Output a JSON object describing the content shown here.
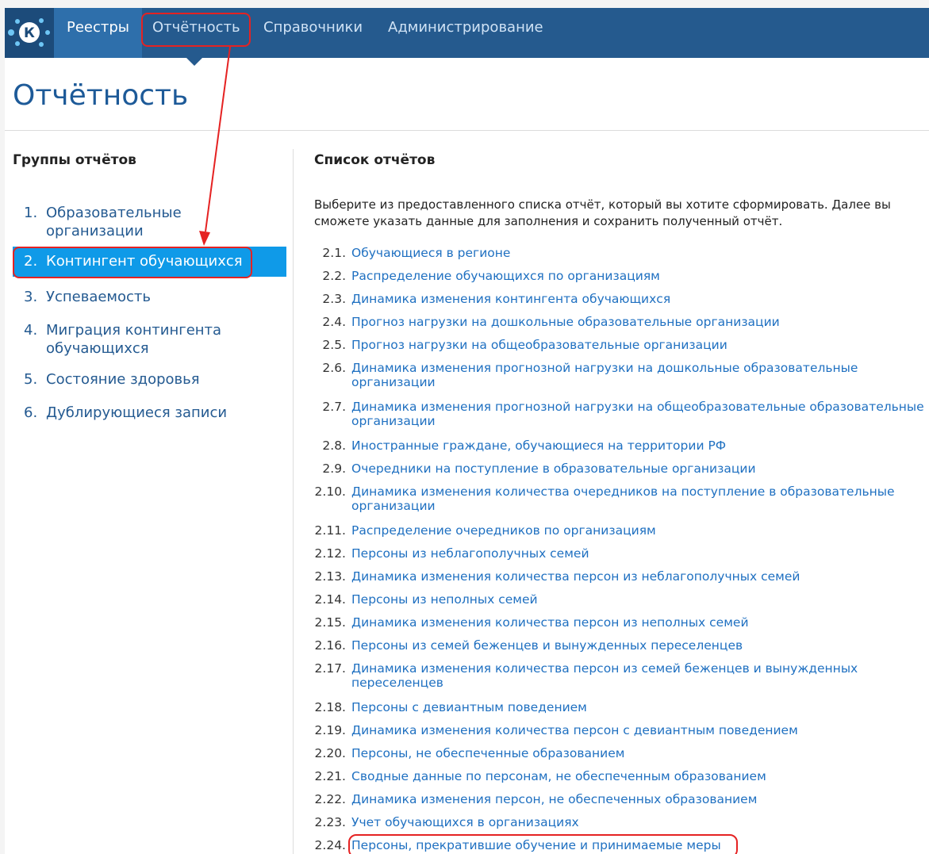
{
  "nav": {
    "logo_letter": "К",
    "items": [
      {
        "label": "Реестры"
      },
      {
        "label": "Отчётность"
      },
      {
        "label": "Справочники"
      },
      {
        "label": "Администрирование"
      }
    ]
  },
  "page": {
    "title": "Отчётность",
    "left_heading": "Группы отчётов",
    "right_heading": "Список отчётов",
    "intro": "Выберите из предоставленного списка отчёт, который вы хотите сформировать. Далее вы сможете указать данные для заполнения и сохранить полученный отчёт."
  },
  "groups": [
    {
      "num": "1.",
      "label": "Образовательные организации"
    },
    {
      "num": "2.",
      "label": "Контингент обучающихся"
    },
    {
      "num": "3.",
      "label": "Успеваемость"
    },
    {
      "num": "4.",
      "label": "Миграция контингента обучающихся"
    },
    {
      "num": "5.",
      "label": "Состояние здоровья"
    },
    {
      "num": "6.",
      "label": "Дублирующиеся записи"
    }
  ],
  "reports": [
    {
      "num": "2.1.",
      "label": "Обучающиеся в регионе"
    },
    {
      "num": "2.2.",
      "label": "Распределение обучающихся по организациям"
    },
    {
      "num": "2.3.",
      "label": "Динамика изменения контингента обучающихся"
    },
    {
      "num": "2.4.",
      "label": "Прогноз нагрузки на дошкольные образовательные организации"
    },
    {
      "num": "2.5.",
      "label": "Прогноз нагрузки на общеобразовательные организации"
    },
    {
      "num": "2.6.",
      "label": "Динамика изменения прогнозной нагрузки на дошкольные образовательные организации"
    },
    {
      "num": "2.7.",
      "label": "Динамика изменения прогнозной нагрузки на общеобразовательные образовательные организации"
    },
    {
      "num": "2.8.",
      "label": "Иностранные граждане, обучающиеся на территории РФ"
    },
    {
      "num": "2.9.",
      "label": "Очередники на поступление в образовательные организации"
    },
    {
      "num": "2.10.",
      "label": "Динамика изменения количества очередников на поступление в образовательные организации"
    },
    {
      "num": "2.11.",
      "label": "Распределение очередников по организациям"
    },
    {
      "num": "2.12.",
      "label": "Персоны из неблагополучных семей"
    },
    {
      "num": "2.13.",
      "label": "Динамика изменения количества персон из неблагополучных семей"
    },
    {
      "num": "2.14.",
      "label": "Персоны из неполных семей"
    },
    {
      "num": "2.15.",
      "label": "Динамика изменения количества персон из неполных семей"
    },
    {
      "num": "2.16.",
      "label": "Персоны из семей беженцев и вынужденных переселенцев"
    },
    {
      "num": "2.17.",
      "label": "Динамика изменения количества персон из семей беженцев и вынужденных переселенцев"
    },
    {
      "num": "2.18.",
      "label": "Персоны с девиантным поведением"
    },
    {
      "num": "2.19.",
      "label": "Динамика изменения количества персон с девиантным поведением"
    },
    {
      "num": "2.20.",
      "label": "Персоны, не обеспеченные образованием"
    },
    {
      "num": "2.21.",
      "label": "Сводные данные по персонам, не обеспеченным образованием"
    },
    {
      "num": "2.22.",
      "label": "Динамика изменения персон, не обеспеченных образованием"
    },
    {
      "num": "2.23.",
      "label": "Учет обучающихся в организациях"
    },
    {
      "num": "2.24.",
      "label": "Персоны, прекратившие обучение и принимаемые меры"
    }
  ],
  "colors": {
    "topbar": "#255a8e",
    "selected_group": "#0f9ae8",
    "link": "#1f70c1",
    "title": "#1d5a98",
    "annotation": "#e52222"
  }
}
